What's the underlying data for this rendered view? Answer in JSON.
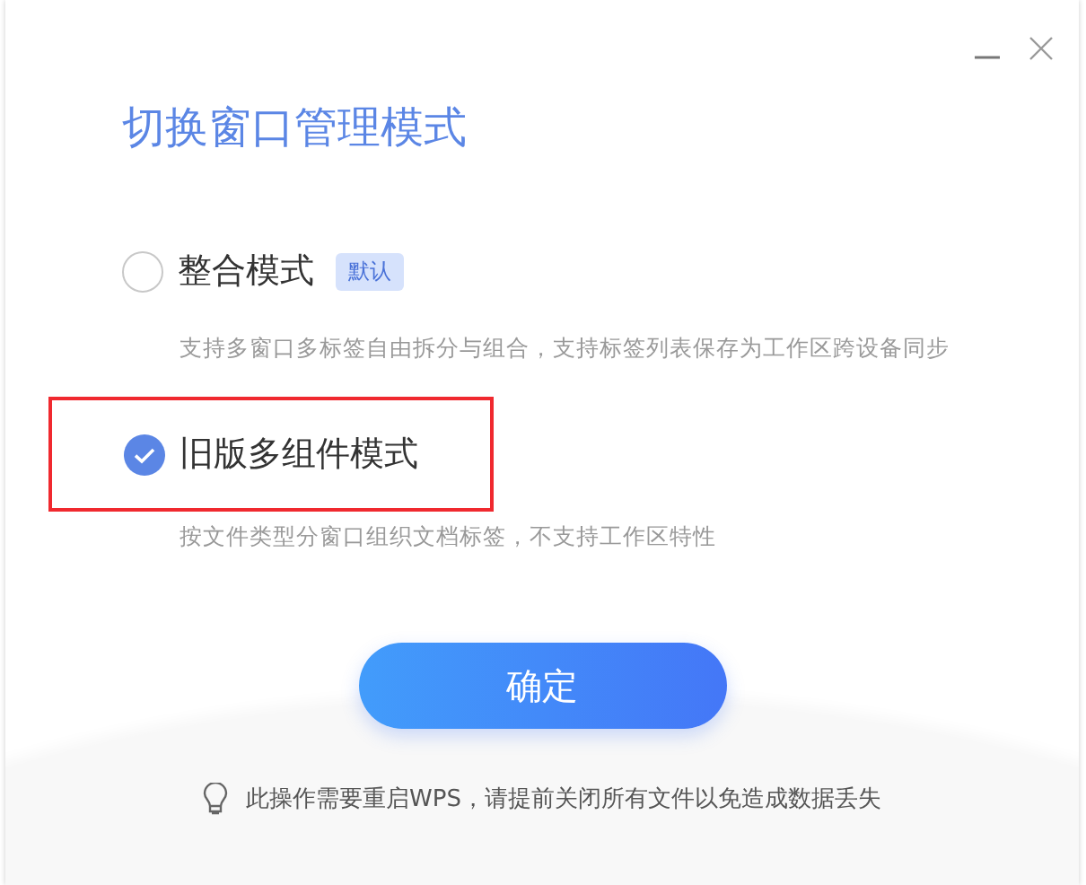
{
  "window": {
    "title": "切换窗口管理模式"
  },
  "options": [
    {
      "label": "整合模式",
      "badge": "默认",
      "description": "支持多窗口多标签自由拆分与组合，支持标签列表保存为工作区跨设备同步",
      "selected": false,
      "highlighted": false
    },
    {
      "label": "旧版多组件模式",
      "description": "按文件类型分窗口组织文档标签，不支持工作区特性",
      "selected": true,
      "highlighted": true
    }
  ],
  "buttons": [
    "确定"
  ],
  "notice": "此操作需要重启WPS，请提前关闭所有文件以免造成数据丢失"
}
